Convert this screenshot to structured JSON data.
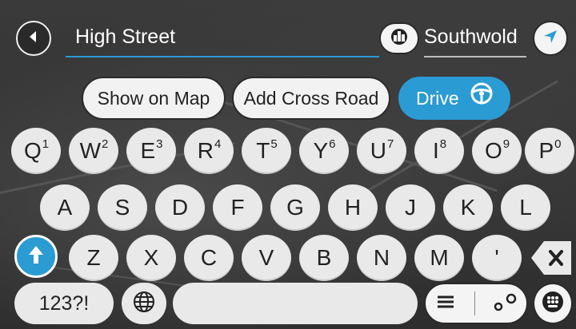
{
  "search": {
    "value": "High Street",
    "location": "Southwold"
  },
  "actions": {
    "show_on_map": "Show on Map",
    "add_cross_road": "Add Cross Road",
    "drive": "Drive"
  },
  "keyboard": {
    "row1": [
      {
        "key": "Q",
        "alt": "1"
      },
      {
        "key": "W",
        "alt": "2"
      },
      {
        "key": "E",
        "alt": "3"
      },
      {
        "key": "R",
        "alt": "4"
      },
      {
        "key": "T",
        "alt": "5"
      },
      {
        "key": "Y",
        "alt": "6"
      },
      {
        "key": "U",
        "alt": "7"
      },
      {
        "key": "I",
        "alt": "8"
      },
      {
        "key": "O",
        "alt": "9"
      },
      {
        "key": "P",
        "alt": "0"
      }
    ],
    "row2": [
      "A",
      "S",
      "D",
      "F",
      "G",
      "H",
      "J",
      "K",
      "L"
    ],
    "row3": [
      "Z",
      "X",
      "C",
      "V",
      "B",
      "N",
      "M",
      "'"
    ],
    "numbers_label": "123?!"
  },
  "icons": {
    "back": "back-arrow-icon",
    "location_type": "city-buildings-icon",
    "current_location": "navigation-arrow-icon",
    "drive": "steering-wheel-icon",
    "shift": "shift-arrow-icon",
    "backspace": "backspace-icon",
    "globe": "globe-icon",
    "list": "list-icon",
    "route": "route-pins-icon",
    "keyboard_options": "keyboard-icon"
  },
  "colors": {
    "accent": "#2a9bd3",
    "key_bg": "#e9e9e9",
    "background": "#333333"
  }
}
